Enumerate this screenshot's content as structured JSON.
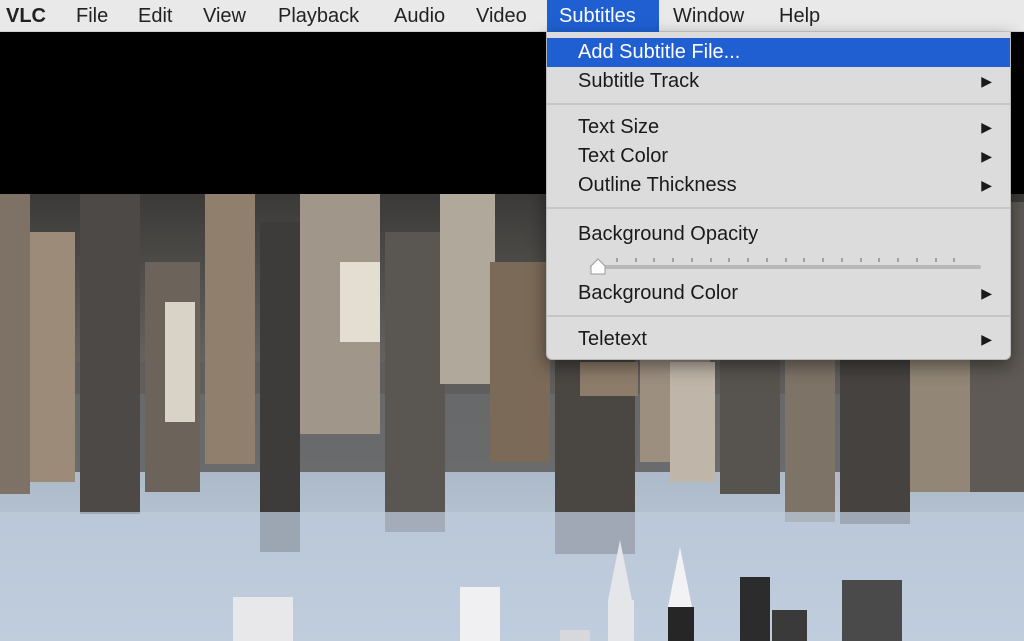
{
  "menubar": {
    "app_name": "VLC",
    "items": [
      "File",
      "Edit",
      "View",
      "Playback",
      "Audio",
      "Video",
      "Subtitles",
      "Window",
      "Help"
    ],
    "active": "Subtitles"
  },
  "subtitles_menu": {
    "add_subtitle_file": "Add Subtitle File...",
    "subtitle_track": "Subtitle Track",
    "text_size": "Text Size",
    "text_color": "Text Color",
    "outline_thickness": "Outline Thickness",
    "background_opacity": "Background Opacity",
    "background_opacity_level": 0,
    "background_color": "Background Color",
    "teletext": "Teletext",
    "submenu_arrow": "▶"
  },
  "colors": {
    "highlight": "#1f5fd1",
    "menubar_bg": "#e9e9e9",
    "menu_bg": "#dcdcdc"
  },
  "icons": [
    "submenu-arrow-icon",
    "slider-thumb-icon"
  ]
}
